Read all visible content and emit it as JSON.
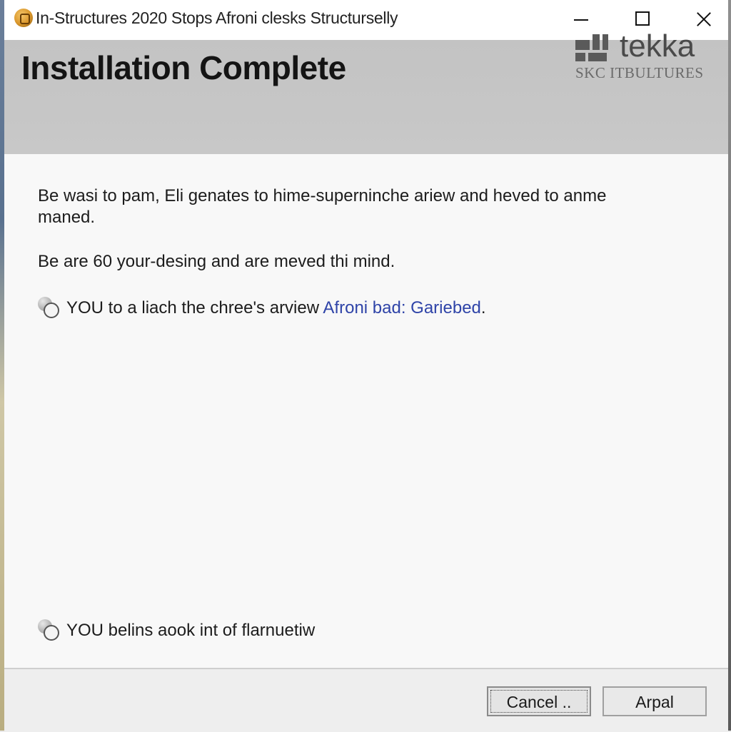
{
  "window": {
    "title": "In-Structures 2020 Stops Afroni clesks Structurselly",
    "icon": "app-icon"
  },
  "header": {
    "heading": "Installation Complete",
    "logo_word": "tekka",
    "logo_sub": "SKC ITBULTURES"
  },
  "content": {
    "paragraph1": "Be wasi to pam, Eli genates to hime-superninche ariew and heved to anme maned.",
    "paragraph2": "Be are 60 your-desing and are meved thi mind.",
    "bullet1_text": "YOU to a liach the chree's arview ",
    "bullet1_link": "Afroni bad: Gariebed",
    "bullet1_tail": ".",
    "bullet2_text": "YOU belins aook int of flarnuetiw"
  },
  "footer": {
    "cancel_label": "Cancel ..",
    "apply_label": "Arpal"
  },
  "colors": {
    "header_band": "#c5c5c5",
    "link": "#2f44a8",
    "window_bg": "#f8f8f8"
  }
}
